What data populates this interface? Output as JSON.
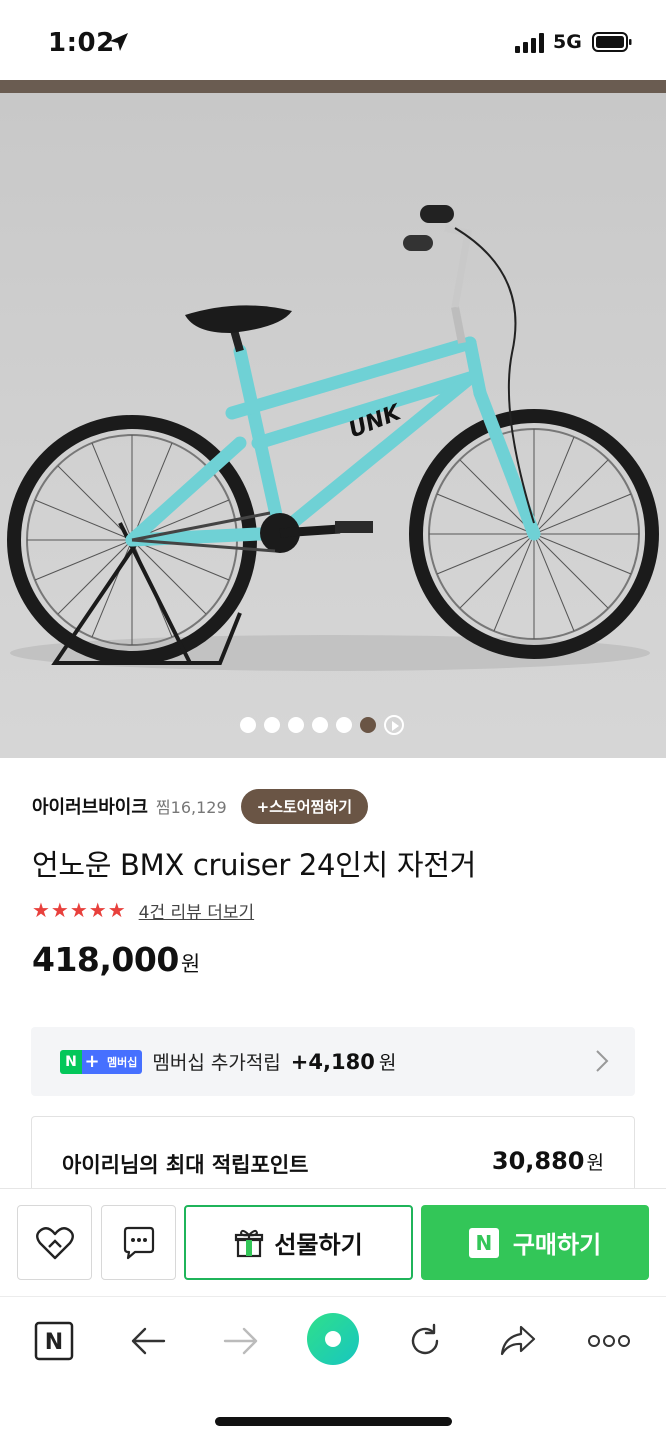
{
  "status_bar": {
    "time": "1:02",
    "network": "5G"
  },
  "hero": {
    "carousel_count": 7,
    "carousel_active_index": 5
  },
  "store": {
    "name": "아이러브바이크",
    "favorites_label": "찜16,129",
    "follow_button": "+스토어찜하기"
  },
  "product": {
    "title": "언노운 BMX cruiser 24인치 자전거",
    "rating_stars": "★★★★★",
    "rating_value": 5,
    "review_link": "4건 리뷰 더보기",
    "price": "418,000",
    "price_unit": "원"
  },
  "membership": {
    "badge_n": "N",
    "badge_plus": "+",
    "badge_text": "멤버십",
    "label": "멤버십 추가적립",
    "points": "+4,180",
    "unit": "원"
  },
  "points_box": {
    "label": "아이리님의 최대 적립포인트",
    "value": "30,880",
    "unit": "원"
  },
  "purchase_bar": {
    "gift_label": "선물하기",
    "buy_n": "N",
    "buy_label": "구매하기"
  },
  "browser_bar": {
    "naver_label": "N"
  },
  "colors": {
    "brand_brown": "#6a5545",
    "naver_green": "#33c658",
    "star_red": "#e8403c",
    "membership_blue": "#4670ff",
    "bike_teal": "#6fd1d5"
  }
}
